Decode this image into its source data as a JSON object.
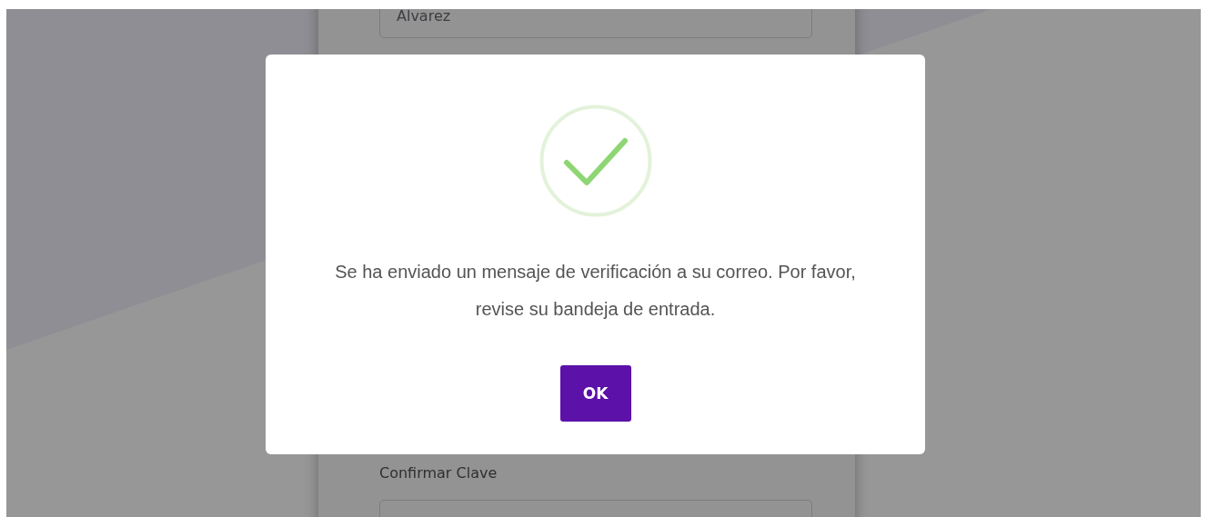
{
  "form": {
    "last_name_field": {
      "value": "Alvarez"
    },
    "confirm_password": {
      "label": "Confirmar Clave"
    }
  },
  "dialog": {
    "message": "Se ha enviado un mensaje de verificación a su correo. Por favor, revise su bandeja de entrada.",
    "button": "OK"
  }
}
